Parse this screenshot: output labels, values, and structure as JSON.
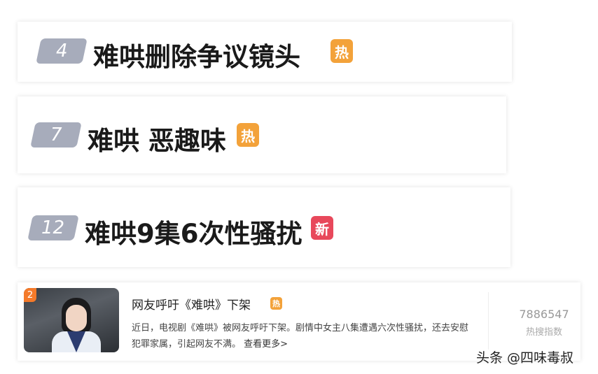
{
  "rows": [
    {
      "rank": "4",
      "title": "难哄删除争议镜头",
      "badge": "热",
      "badge_type": "hot"
    },
    {
      "rank": "7",
      "title": "难哄 恶趣味",
      "badge": "热",
      "badge_type": "hot"
    },
    {
      "rank": "12",
      "title": "难哄9集6次性骚扰",
      "badge": "新",
      "badge_type": "new"
    }
  ],
  "news": {
    "position": "2",
    "title": "网友呼吁《难哄》下架",
    "badge": "热",
    "description": "近日，电视剧《难哄》被网友呼吁下架。剧情中女主八集遭遇六次性骚扰，还去安慰犯罪家属，引起网友不满。",
    "more_link": "查看更多>",
    "heat_value": "7886547",
    "heat_label": "热搜指数"
  },
  "watermark": "头条 @四味毒叔",
  "colors": {
    "hot": "#f3a23a",
    "new": "#e8485b",
    "rank_bg": "#a7acbb"
  }
}
